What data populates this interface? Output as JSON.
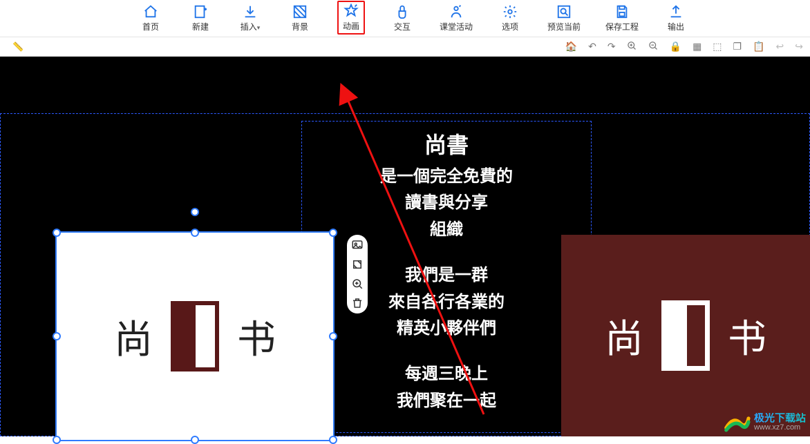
{
  "ribbon": [
    {
      "id": "home",
      "label": "首页"
    },
    {
      "id": "new",
      "label": "新建"
    },
    {
      "id": "insert",
      "label": "插入",
      "caret": true
    },
    {
      "id": "bg",
      "label": "背景"
    },
    {
      "id": "anim",
      "label": "动画",
      "highlight": true
    },
    {
      "id": "interact",
      "label": "交互"
    },
    {
      "id": "class",
      "label": "课堂活动"
    },
    {
      "id": "options",
      "label": "选项"
    },
    {
      "id": "preview",
      "label": "预览当前"
    },
    {
      "id": "save",
      "label": "保存工程"
    },
    {
      "id": "export",
      "label": "输出"
    }
  ],
  "subbar_left_icon": "ruler",
  "subbar_icons": [
    "home",
    "undo",
    "redo",
    "zoom-in",
    "zoom-out",
    "lock",
    "grid",
    "ai",
    "copy",
    "paste",
    "back",
    "forward"
  ],
  "content": {
    "title": "尚書",
    "lines1": [
      "是一個完全免費的",
      "讀書與分享",
      "組織"
    ],
    "lines2": [
      "我們是一群",
      "來自各行各業的",
      "精英小夥伴們"
    ],
    "lines3": [
      "每週三晚上",
      "我們聚在一起"
    ]
  },
  "logo": {
    "left_char": "尚",
    "right_char": "书"
  },
  "pill_tools": [
    "image",
    "crop",
    "zoom",
    "delete"
  ],
  "watermark": {
    "brand": "极光下载站",
    "url": "www.xz7.com"
  }
}
